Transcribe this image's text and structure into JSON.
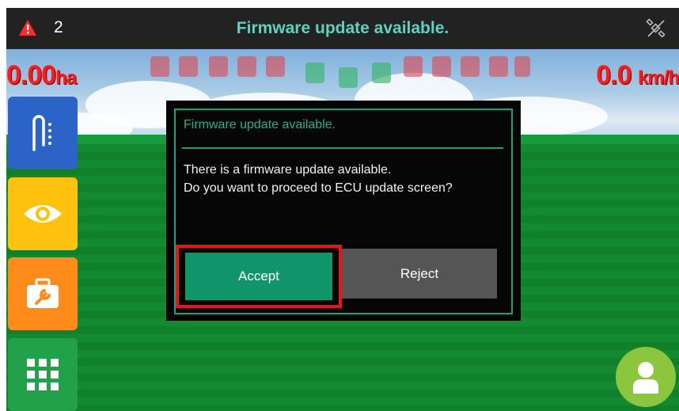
{
  "topbar": {
    "alert_count": "2",
    "title": "Firmware update available.",
    "alert_icon": "warning-triangle-icon",
    "gps_icon": "satellite-icon"
  },
  "readouts": {
    "area_value": "0.00",
    "area_unit": "ha",
    "speed_value": "0.0",
    "speed_unit": "km/h"
  },
  "side_buttons": [
    {
      "icon": "guidance-path-icon"
    },
    {
      "icon": "eye-icon"
    },
    {
      "icon": "toolbox-icon"
    },
    {
      "icon": "grid-menu-icon"
    }
  ],
  "user_button": {
    "icon": "user-icon"
  },
  "dialog": {
    "title": "Firmware update available.",
    "message_line1": "There is a firmware update available.",
    "message_line2": "Do you want to proceed to ECU update screen?",
    "accept_label": "Accept",
    "reject_label": "Reject"
  },
  "colors": {
    "title_teal": "#5fd1c0",
    "dialog_accent": "#1aa37a",
    "accept_green": "#10956a",
    "reject_gray": "#555555",
    "highlight_red": "#e8151b",
    "readout_red": "#ff1a1a"
  }
}
